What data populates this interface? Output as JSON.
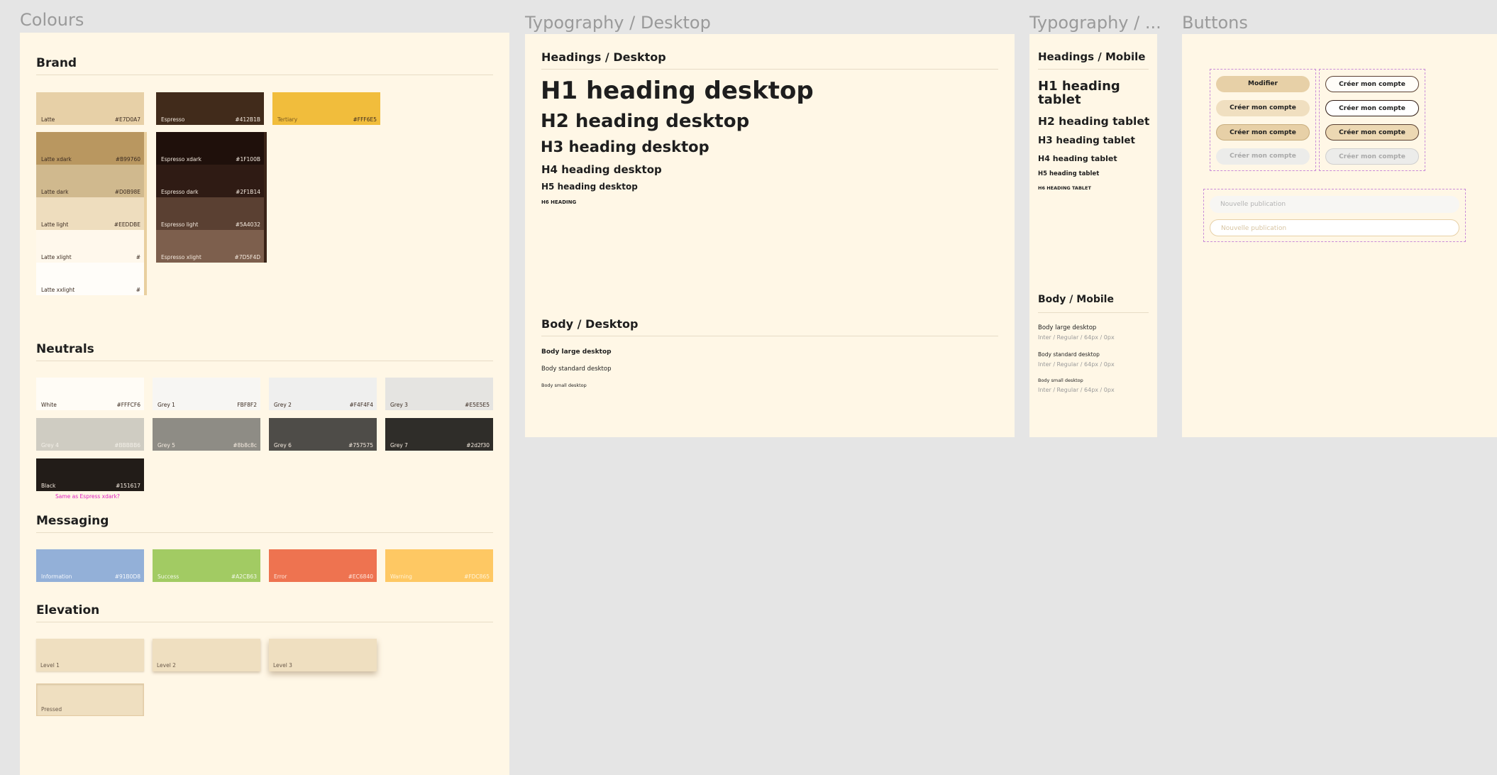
{
  "frames": {
    "colours": "Colours",
    "typo_desktop": "Typography / Desktop",
    "typo_mobile": "Typography / ...",
    "buttons": "Buttons"
  },
  "colours": {
    "sections": {
      "brand": "Brand",
      "neutrals": "Neutrals",
      "messaging": "Messaging",
      "elevation": "Elevation"
    },
    "brand_top": [
      {
        "name": "Latte",
        "hex": "#E7D0A7",
        "color": "#e7d0a7"
      },
      {
        "name": "Espresso",
        "hex": "#412B1B",
        "color": "#412b1b"
      },
      {
        "name": "Tertiary",
        "hex": "#FFF6E5",
        "color": "#f1bd3c"
      }
    ],
    "latte_shades": [
      {
        "name": "Latte xdark",
        "hex": "#B99760",
        "color": "#b99760"
      },
      {
        "name": "Latte dark",
        "hex": "#D0B98E",
        "color": "#d0b98e"
      },
      {
        "name": "Latte light",
        "hex": "#EEDDBE",
        "color": "#eeddbe"
      },
      {
        "name": "Latte xlight",
        "hex": "#",
        "color": "#fff8ec"
      },
      {
        "name": "Latte xxlight",
        "hex": "#",
        "color": "#fffdf9"
      }
    ],
    "espresso_shades": [
      {
        "name": "Espresso xdark",
        "hex": "#1F100B",
        "color": "#1f100b"
      },
      {
        "name": "Espresso dark",
        "hex": "#2F1B14",
        "color": "#2f1b14"
      },
      {
        "name": "Espresso light",
        "hex": "#5A4032",
        "color": "#5a4032"
      },
      {
        "name": "Espresso xlight",
        "hex": "#7D5F4D",
        "color": "#7d5f4d"
      }
    ],
    "neutrals": [
      {
        "name": "White",
        "hex": "#FFFCF6",
        "color": "#fffcf6"
      },
      {
        "name": "Grey 1",
        "hex": "FBF8F2",
        "color": "#f7f6f3"
      },
      {
        "name": "Grey 2",
        "hex": "#F4F4F4",
        "color": "#efefee"
      },
      {
        "name": "Grey 3",
        "hex": "#E5E5E5",
        "color": "#e5e4e1"
      },
      {
        "name": "Grey 4",
        "hex": "#BBBBB6",
        "color": "#cfccc2"
      },
      {
        "name": "Grey 5",
        "hex": "#8b8c8c",
        "color": "#8e8c85"
      },
      {
        "name": "Grey 6",
        "hex": "#757575",
        "color": "#4e4c48"
      },
      {
        "name": "Grey 7",
        "hex": "#2d2f30",
        "color": "#2f2d29"
      },
      {
        "name": "Black",
        "hex": "#151617",
        "color": "#221c18"
      }
    ],
    "black_note": "Same as Espress xdark?",
    "messaging": [
      {
        "name": "Information",
        "hex": "#91B0D8",
        "color": "#93b0d8"
      },
      {
        "name": "Success",
        "hex": "#A2CB63",
        "color": "#a2cb63"
      },
      {
        "name": "Error",
        "hex": "#EC6840",
        "color": "#ee7350"
      },
      {
        "name": "Warning",
        "hex": "#FDC865",
        "color": "#fec863"
      }
    ],
    "elevation": [
      {
        "name": "Level 1"
      },
      {
        "name": "Level 2"
      },
      {
        "name": "Level 3"
      },
      {
        "name": "Pressed"
      }
    ]
  },
  "typo_desktop": {
    "headings_title": "Headings / Desktop",
    "h1": "H1 heading desktop",
    "h2": "H2 heading desktop",
    "h3": "H3 heading desktop",
    "h4": "H4 heading desktop",
    "h5": "H5 heading desktop",
    "h6": "H6 HEADING",
    "body_title": "Body / Desktop",
    "body_large": "Body large desktop",
    "body_standard": "Body standard desktop",
    "body_small": "Body small desktop"
  },
  "typo_mobile": {
    "headings_title": "Headings / Mobile",
    "h1": "H1 heading tablet",
    "h2": "H2 heading tablet",
    "h3": "H3 heading tablet",
    "h4": "H4 heading tablet",
    "h5": "H5 heading tablet",
    "h6": "H6 HEADING TABLET",
    "body_title": "Body / Mobile",
    "body_large": "Body large desktop",
    "body_large_meta": "Inter / Regular / 64px / 0px",
    "body_standard": "Body standard desktop",
    "body_standard_meta": "Inter / Regular / 64px / 0px",
    "body_small": "Body small desktop",
    "body_small_meta": "Inter / Regular / 64px / 0px"
  },
  "buttons": {
    "filled": [
      "Modifier",
      "Créer mon compte",
      "Créer mon compte",
      "Créer mon compte"
    ],
    "outlined": [
      "Créer mon compte",
      "Créer mon compte",
      "Créer mon compte",
      "Créer mon compte"
    ],
    "inputs": [
      "Nouvelle publication",
      "Nouvelle publication"
    ]
  }
}
